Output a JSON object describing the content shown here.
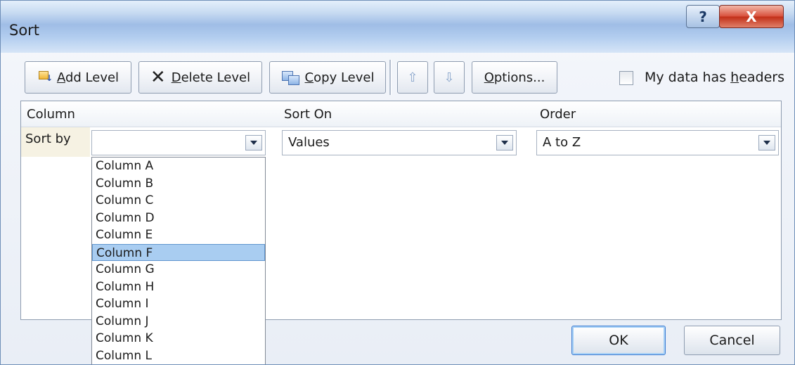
{
  "window": {
    "title": "Sort",
    "help_label": "?",
    "close_label": "X"
  },
  "toolbar": {
    "add_level": {
      "prefix": "",
      "accel": "A",
      "rest": "dd Level"
    },
    "delete_level": {
      "prefix": "",
      "accel": "D",
      "rest": "elete Level"
    },
    "copy_level": {
      "prefix": "",
      "accel": "C",
      "rest": "opy Level"
    },
    "move_up_label": "⇧",
    "move_down_label": "⇩",
    "options": {
      "prefix": "",
      "accel": "O",
      "rest": "ptions..."
    },
    "headers_checkbox": {
      "prefix": "My data has ",
      "accel": "h",
      "rest": "eaders",
      "checked": false
    }
  },
  "grid": {
    "headers": [
      "Column",
      "Sort On",
      "Order"
    ],
    "row_label": "Sort by",
    "column_value": "",
    "sort_on_value": "Values",
    "order_value": "A to Z"
  },
  "column_dropdown": {
    "options": [
      "Column A",
      "Column B",
      "Column C",
      "Column D",
      "Column E",
      "Column F",
      "Column G",
      "Column H",
      "Column I",
      "Column J",
      "Column K",
      "Column L"
    ],
    "highlighted": "Column F"
  },
  "buttons": {
    "ok": "OK",
    "cancel": "Cancel"
  }
}
